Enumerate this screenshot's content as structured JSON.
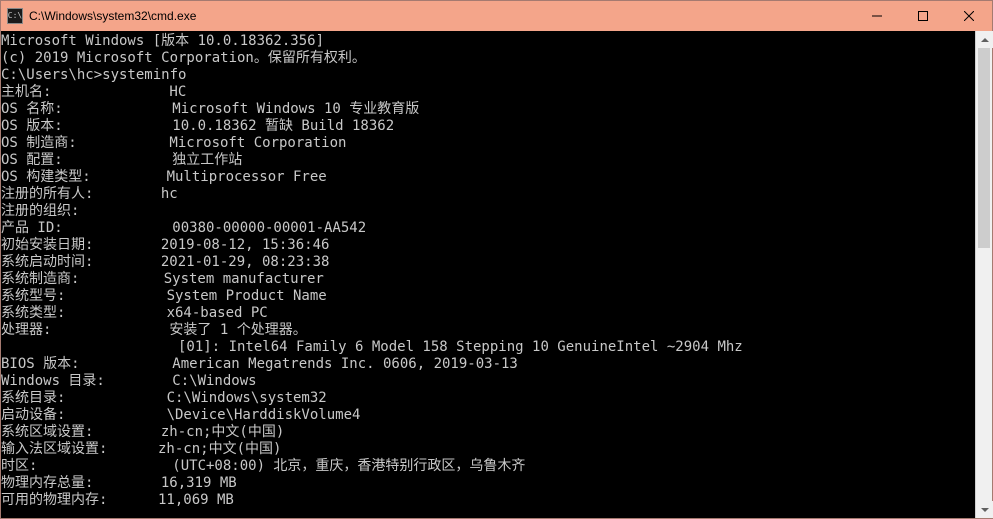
{
  "titlebar": {
    "icon_label": "C:\\",
    "title": "C:\\Windows\\system32\\cmd.exe"
  },
  "banner": {
    "line1": "Microsoft Windows [版本 10.0.18362.356]",
    "line2": "(c) 2019 Microsoft Corporation。保留所有权利。"
  },
  "prompt": {
    "text": "C:\\Users\\hc>",
    "command": "systeminfo"
  },
  "systeminfo": {
    "rows": [
      {
        "label": "主机名:",
        "value": "HC"
      },
      {
        "label": "OS 名称:",
        "value": "Microsoft Windows 10 专业教育版"
      },
      {
        "label": "OS 版本:",
        "value": "10.0.18362 暂缺 Build 18362"
      },
      {
        "label": "OS 制造商:",
        "value": "Microsoft Corporation"
      },
      {
        "label": "OS 配置:",
        "value": "独立工作站"
      },
      {
        "label": "OS 构建类型:",
        "value": "Multiprocessor Free"
      },
      {
        "label": "注册的所有人:",
        "value": "hc"
      },
      {
        "label": "注册的组织:",
        "value": ""
      },
      {
        "label": "产品 ID:",
        "value": "00380-00000-00001-AA542"
      },
      {
        "label": "初始安装日期:",
        "value": "2019-08-12, 15:36:46"
      },
      {
        "label": "系统启动时间:",
        "value": "2021-01-29, 08:23:38"
      },
      {
        "label": "系统制造商:",
        "value": "System manufacturer"
      },
      {
        "label": "系统型号:",
        "value": "System Product Name"
      },
      {
        "label": "系统类型:",
        "value": "x64-based PC"
      },
      {
        "label": "处理器:",
        "value": "安装了 1 个处理器。"
      },
      {
        "label": "",
        "value": "[01]: Intel64 Family 6 Model 158 Stepping 10 GenuineIntel ~2904 Mhz"
      },
      {
        "label": "BIOS 版本:",
        "value": "American Megatrends Inc. 0606, 2019-03-13"
      },
      {
        "label": "Windows 目录:",
        "value": "C:\\Windows"
      },
      {
        "label": "系统目录:",
        "value": "C:\\Windows\\system32"
      },
      {
        "label": "启动设备:",
        "value": "\\Device\\HarddiskVolume4"
      },
      {
        "label": "系统区域设置:",
        "value": "zh-cn;中文(中国)"
      },
      {
        "label": "输入法区域设置:",
        "value": "zh-cn;中文(中国)"
      },
      {
        "label": "时区:",
        "value": "(UTC+08:00) 北京，重庆，香港特别行政区，乌鲁木齐"
      },
      {
        "label": "物理内存总量:",
        "value": "16,319 MB"
      },
      {
        "label": "可用的物理内存:",
        "value": "11,069 MB"
      }
    ]
  }
}
